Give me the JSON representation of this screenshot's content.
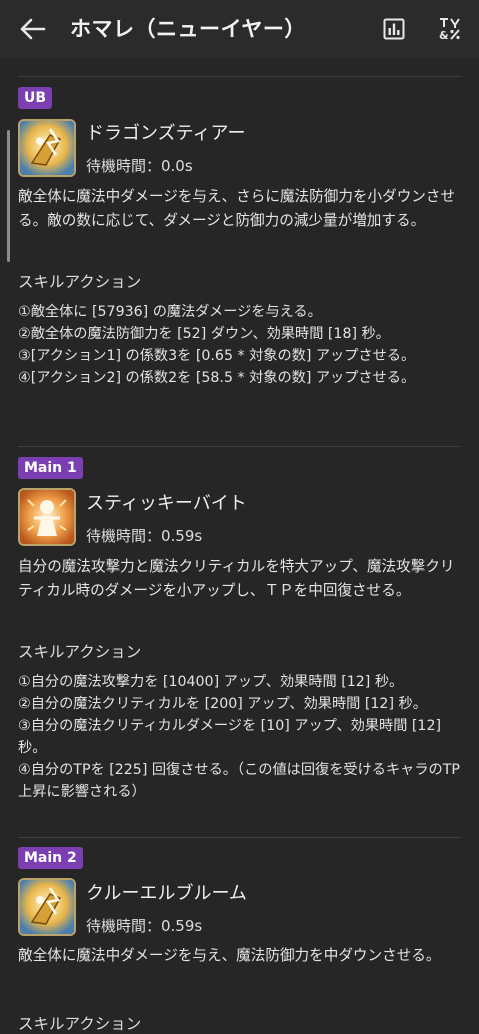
{
  "header": {
    "title": "ホマレ（ニューイヤー）",
    "back_icon": "arrow-left-icon",
    "stats_icon": "bar-chart-icon",
    "format_icon": "text-format-icon"
  },
  "skills": [
    {
      "badge": "UB",
      "name": "ドラゴンズティアー",
      "cast_time": "待機時間：0.0s",
      "description": "敵全体に魔法中ダメージを与え、さらに魔法防御力を小ダウンさせる。敵の数に応じて、ダメージと防御力の減少量が増加する。",
      "section_title": "スキルアクション",
      "actions": [
        "①敵全体に [57936] の魔法ダメージを与える。",
        "②敵全体の魔法防御力を [52] ダウン、効果時間 [18] 秒。",
        "③[アクション1] の係数3を [0.65 * 対象の数] アップさせる。",
        "④[アクション2] の係数2を [58.5 * 対象の数] アップさせる。"
      ]
    },
    {
      "badge": "Main 1",
      "name": "スティッキーバイト",
      "cast_time": "待機時間：0.59s",
      "description": "自分の魔法攻撃力と魔法クリティカルを特大アップ、魔法攻撃クリティカル時のダメージを小アップし、ＴＰを中回復させる。",
      "section_title": "スキルアクション",
      "actions": [
        "①自分の魔法攻撃力を [10400] アップ、効果時間 [12] 秒。",
        "②自分の魔法クリティカルを [200] アップ、効果時間 [12] 秒。",
        "③自分の魔法クリティカルダメージを [10] アップ、効果時間 [12] 秒。",
        "④自分のTPを [225] 回復させる。（この値は回復を受けるキャラのTP上昇に影響される）"
      ]
    },
    {
      "badge": "Main 2",
      "name": "クルーエルブルーム",
      "cast_time": "待機時間：0.59s",
      "description": "敵全体に魔法中ダメージを与え、魔法防御力を中ダウンさせる。",
      "section_title": "スキルアクション"
    }
  ]
}
